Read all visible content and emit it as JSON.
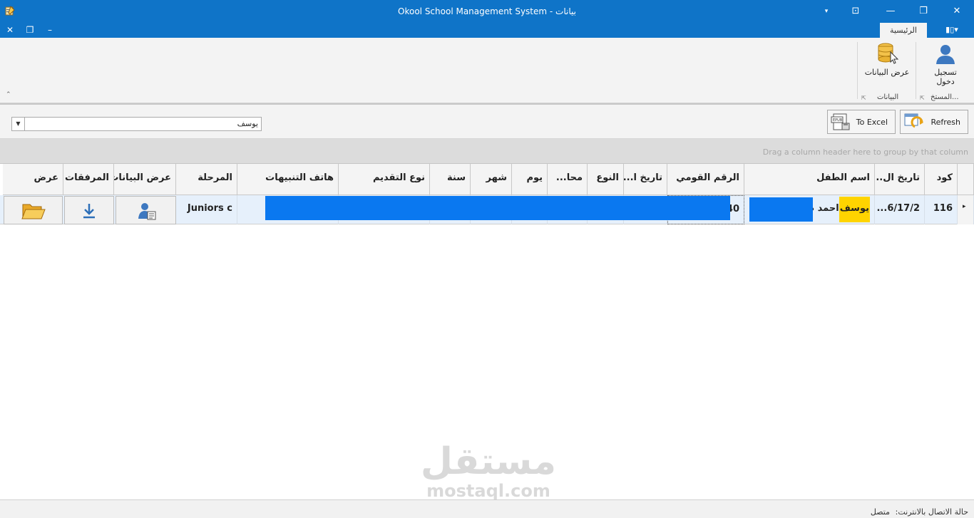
{
  "window": {
    "title": "Okool School Management System - بيانات",
    "controls": {
      "options": "▾",
      "ribbon_display": "⊡",
      "minimize": "—",
      "restore": "❐",
      "close": "✕"
    }
  },
  "mdi_controls": {
    "close": "✕",
    "restore": "❐",
    "minimize": "–"
  },
  "ribbon": {
    "tabs": [
      {
        "label": "الرئيسية",
        "active": true
      }
    ],
    "layout_button": "▮▯▾",
    "groups": [
      {
        "label": "المستخ...",
        "buttons": [
          {
            "label_line1": "تسجيل",
            "label_line2": "دخول",
            "icon": "user-icon"
          }
        ]
      },
      {
        "label": "البيانات",
        "buttons": [
          {
            "label": "عرض البيانات",
            "icon": "database-icon"
          }
        ]
      }
    ],
    "collapse_glyph": "⌃",
    "launcher_glyph": "⇱"
  },
  "toolbar": {
    "search_value": "يوسف",
    "dropdown_glyph": "▼",
    "refresh_label": "Refresh",
    "excel_label": "To Excel"
  },
  "group_panel_hint": "Drag a column header here to group by that column",
  "grid": {
    "headers": {
      "code": "كود",
      "register_date": "تاريخ ال...",
      "child_name": "اسم الطفل",
      "national_id": "الرقم القومي",
      "birth_date": "تاريخ ا...",
      "gender": "النوع",
      "governorate": "محا...",
      "day": "يوم",
      "month": "شهر",
      "year": "سنة",
      "application_type": "نوع التقديم",
      "notify_phone": "هاتف التنبيهات",
      "stage": "المرحلة",
      "view_data": "عرض البيانات",
      "attachments": "المرفقات",
      "view": "عرض"
    },
    "rows": [
      {
        "indicator": "▸",
        "code": "116",
        "register_date": "6/17/2...",
        "child_name_highlight": "يوسف",
        "child_name_rest": "احمد م",
        "national_id_tail": "40",
        "stage": "Juniors c"
      }
    ]
  },
  "statusbar": {
    "label": "حالة الاتصال بالانترنت:",
    "value": "متصل"
  },
  "watermark": {
    "text_ar": "مستقل",
    "text_en": "mostaql.com"
  }
}
